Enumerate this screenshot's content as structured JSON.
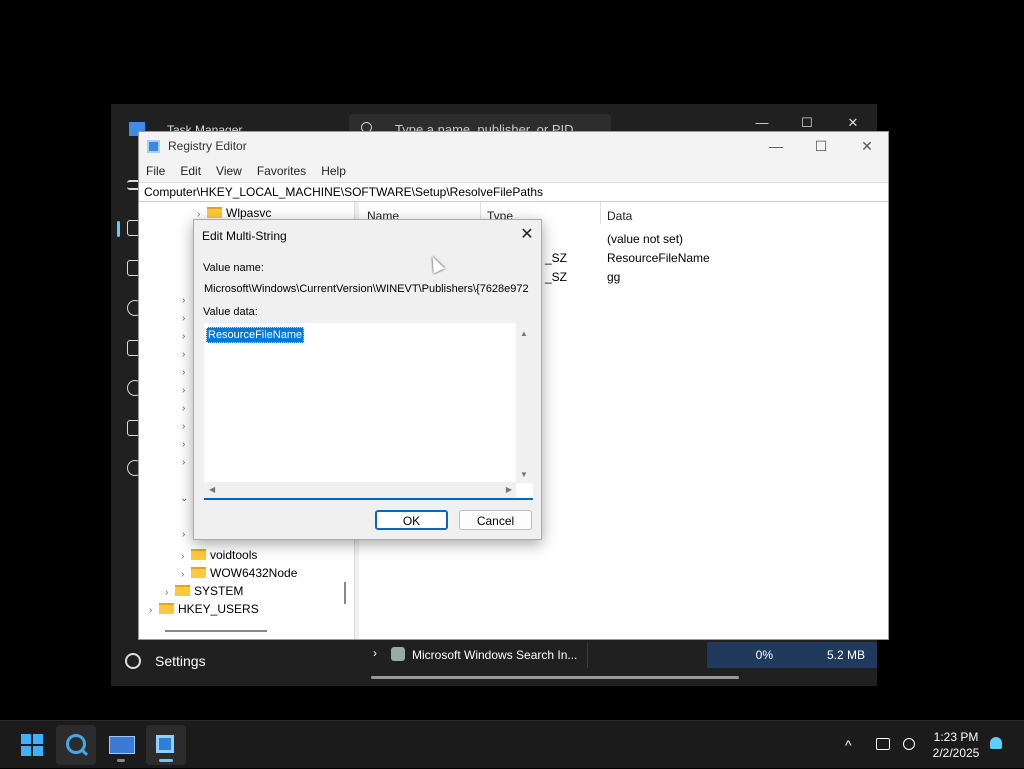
{
  "task_manager": {
    "title": "Task Manager",
    "search_placeholder": "Type a name, publisher, or PID",
    "minimize": "—",
    "maximize": "☐",
    "close": "✕",
    "settings_label": "Settings",
    "process_row": {
      "name": "Microsoft Windows Search In...",
      "cpu": "0%",
      "memory": "5.2 MB"
    }
  },
  "registry_editor": {
    "title": "Registry Editor",
    "minimize": "—",
    "maximize": "☐",
    "close": "✕",
    "menu": [
      "File",
      "Edit",
      "View",
      "Favorites",
      "Help"
    ],
    "address": "Computer\\HKEY_LOCAL_MACHINE\\SOFTWARE\\Setup\\ResolveFilePaths",
    "tree": {
      "wlpasvc": "Wlpasvc",
      "voidtools": "voidtools",
      "wow6432node": "WOW6432Node",
      "system": "SYSTEM",
      "hkey_users": "HKEY_USERS"
    },
    "columns": {
      "name": "Name",
      "type": "Type",
      "data": "Data"
    },
    "rows": [
      {
        "type": "",
        "data": "(value not set)"
      },
      {
        "type": "_SZ",
        "data": "ResourceFileName"
      },
      {
        "type": "_SZ",
        "data": "gg"
      }
    ]
  },
  "dialog": {
    "title": "Edit Multi-String",
    "close": "✕",
    "value_name_label": "Value name:",
    "value_name": "Microsoft\\Windows\\CurrentVersion\\WINEVT\\Publishers\\{7628e972",
    "value_data_label": "Value data:",
    "value_data": "ResourceFileName",
    "ok_label": "OK",
    "cancel_label": "Cancel"
  },
  "taskbar": {
    "time": "1:23 PM",
    "date": "2/2/2025",
    "tray_chevron": "^"
  },
  "colors": {
    "accent": "#0078d7",
    "taskbar_bg": "#1b1b1b",
    "task_manager_bg": "#202020"
  }
}
